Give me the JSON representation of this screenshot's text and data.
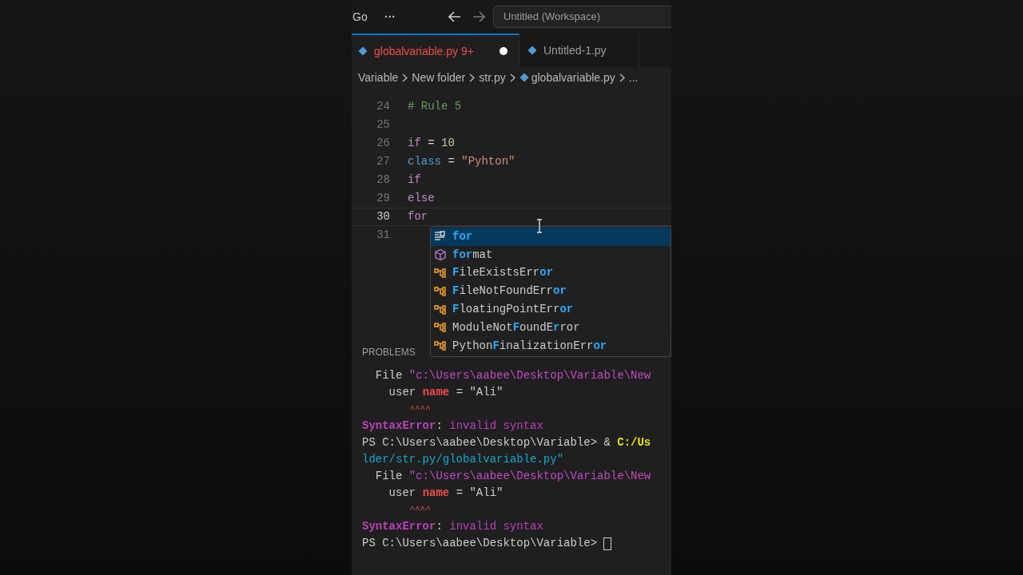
{
  "title_bar": {
    "menu": "Go",
    "more": "···",
    "search": "Untitled (Workspace)"
  },
  "tabs": [
    {
      "label": "globalvariable.py",
      "problems": "9+",
      "modified": true,
      "selected": true
    },
    {
      "label": "Untitled-1.py",
      "modified": false,
      "selected": false
    }
  ],
  "breadcrumbs": [
    {
      "label": "Variable",
      "kind": "folder"
    },
    {
      "label": "New folder",
      "kind": "folder"
    },
    {
      "label": "str.py",
      "kind": "folder"
    },
    {
      "label": "globalvariable.py",
      "kind": "file"
    },
    {
      "label": "...",
      "kind": "more"
    }
  ],
  "editor": {
    "lines": [
      {
        "number": "24",
        "current": false,
        "tokens": [
          {
            "kind": "comment",
            "text": "# Rule 5"
          }
        ]
      },
      {
        "number": "25",
        "current": false
      },
      {
        "number": "26",
        "current": false,
        "tokens": [
          {
            "kind": "keyword",
            "text": "if"
          },
          {
            "kind": "plain",
            "text": " = "
          },
          {
            "kind": "number",
            "text": "10"
          }
        ]
      },
      {
        "number": "27",
        "current": false,
        "tokens": [
          {
            "kind": "storage",
            "text": "class"
          },
          {
            "kind": "plain",
            "text": " = "
          },
          {
            "kind": "string",
            "text": "\"Pyhton\""
          }
        ]
      },
      {
        "number": "28",
        "current": false,
        "tokens": [
          {
            "kind": "keyword",
            "text": "if"
          }
        ]
      },
      {
        "number": "29",
        "current": false,
        "tokens": [
          {
            "kind": "keyword",
            "text": "else"
          }
        ]
      },
      {
        "number": "30",
        "current": true,
        "tokens": [
          {
            "kind": "keyword",
            "text": "for"
          }
        ]
      },
      {
        "number": "31",
        "current": false
      }
    ],
    "suggestions": [
      {
        "kind": "keyword",
        "selected": true,
        "parts": [
          {
            "text": "for",
            "match": true
          }
        ]
      },
      {
        "kind": "module",
        "selected": false,
        "parts": [
          {
            "text": "for",
            "match": true
          },
          {
            "text": "mat",
            "match": false
          }
        ]
      },
      {
        "kind": "class",
        "selected": false,
        "parts": [
          {
            "text": "F",
            "match": true
          },
          {
            "text": "ileExistsErr",
            "match": false
          },
          {
            "text": "or",
            "match": true
          }
        ]
      },
      {
        "kind": "class",
        "selected": false,
        "parts": [
          {
            "text": "F",
            "match": true
          },
          {
            "text": "ileNotFoundErr",
            "match": false
          },
          {
            "text": "or",
            "match": true
          }
        ]
      },
      {
        "kind": "class",
        "selected": false,
        "parts": [
          {
            "text": "F",
            "match": true
          },
          {
            "text": "loatingPointErr",
            "match": false
          },
          {
            "text": "or",
            "match": true
          }
        ]
      },
      {
        "kind": "class",
        "selected": false,
        "parts": [
          {
            "text": "ModuleNot",
            "match": false
          },
          {
            "text": "F",
            "match": true
          },
          {
            "text": "ound",
            "match": false
          },
          {
            "text": "E",
            "match": false
          },
          {
            "text": "r",
            "match": true
          },
          {
            "text": "ror",
            "match": false
          }
        ]
      },
      {
        "kind": "class",
        "selected": false,
        "parts": [
          {
            "text": "Python",
            "match": false
          },
          {
            "text": "F",
            "match": true
          },
          {
            "text": "inalizationErr",
            "match": false
          },
          {
            "text": "or",
            "match": true
          }
        ]
      }
    ]
  },
  "panel": {
    "tab": "PROBLEMS"
  },
  "terminal": {
    "lines": [
      {
        "cursor": false,
        "segments": [
          {
            "kind": "plain",
            "text": "  File "
          },
          {
            "kind": "path",
            "text": "\"c:\\Users\\aabee\\Desktop\\Variable\\New"
          }
        ]
      },
      {
        "cursor": false,
        "segments": [
          {
            "kind": "plain",
            "text": "    user "
          },
          {
            "kind": "error",
            "text": "name"
          },
          {
            "kind": "plain",
            "text": " = \"Ali\""
          }
        ]
      },
      {
        "cursor": false,
        "segments": [
          {
            "kind": "caret",
            "text": "         ^^^^"
          }
        ]
      },
      {
        "cursor": false,
        "segments": [
          {
            "kind": "error_name",
            "text": "SyntaxError"
          },
          {
            "kind": "plain",
            "text": ": "
          },
          {
            "kind": "message",
            "text": "invalid syntax"
          }
        ]
      },
      {
        "cursor": false,
        "segments": [
          {
            "kind": "plain",
            "text": "PS C:\\Users\\aabee\\Desktop\\Variable> & "
          },
          {
            "kind": "command",
            "text": "C:/Us"
          }
        ]
      },
      {
        "cursor": false,
        "segments": [
          {
            "kind": "argument",
            "text": "lder/str.py/globalvariable.py\""
          }
        ]
      },
      {
        "cursor": false,
        "segments": [
          {
            "kind": "plain",
            "text": "  File "
          },
          {
            "kind": "path",
            "text": "\"c:\\Users\\aabee\\Desktop\\Variable\\New"
          }
        ]
      },
      {
        "cursor": false,
        "segments": [
          {
            "kind": "plain",
            "text": "    user "
          },
          {
            "kind": "error",
            "text": "name"
          },
          {
            "kind": "plain",
            "text": " = \"Ali\""
          }
        ]
      },
      {
        "cursor": false,
        "segments": [
          {
            "kind": "caret",
            "text": "         ^^^^"
          }
        ]
      },
      {
        "cursor": false,
        "segments": [
          {
            "kind": "error_name",
            "text": "SyntaxError"
          },
          {
            "kind": "plain",
            "text": ": "
          },
          {
            "kind": "message",
            "text": "invalid syntax"
          }
        ]
      },
      {
        "cursor": true,
        "segments": [
          {
            "kind": "plain",
            "text": "PS C:\\Users\\aabee\\Desktop\\Variable> "
          }
        ]
      }
    ]
  }
}
